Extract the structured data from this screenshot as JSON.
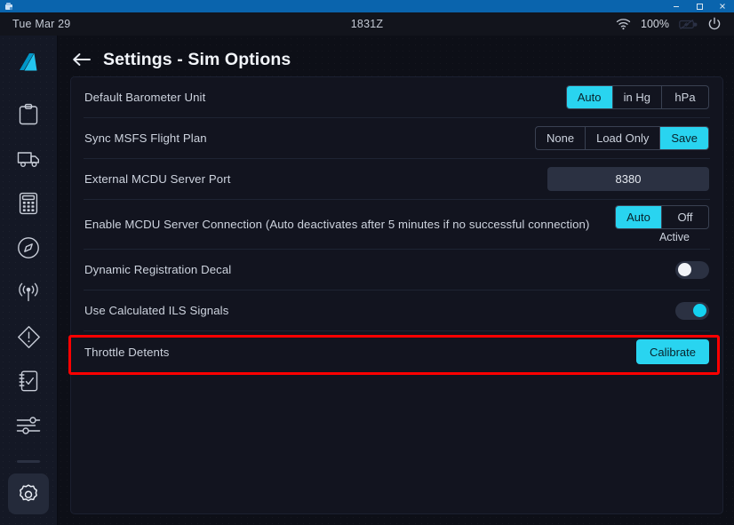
{
  "window": {
    "icon": "app-window-icon",
    "controls": [
      {
        "name": "minimize",
        "glyph": "—"
      },
      {
        "name": "maximize",
        "glyph": "☐"
      },
      {
        "name": "close",
        "glyph": "✕"
      }
    ],
    "titlebar_color": "#0a64ad"
  },
  "statusbar": {
    "date": "Tue Mar 29",
    "time": "1831Z",
    "wifi_icon": "wifi-icon",
    "battery_percent": "100%",
    "battery_icon": "battery-charging-icon",
    "power_icon": "power-icon"
  },
  "sidebar": {
    "items": [
      {
        "name": "fbw-tail-logo",
        "icon": "airplane-tail-logo-icon",
        "active": false
      },
      {
        "name": "dispatch",
        "icon": "clipboard-icon",
        "active": false
      },
      {
        "name": "ground",
        "icon": "truck-icon",
        "active": false
      },
      {
        "name": "performance",
        "icon": "calculator-icon",
        "active": false
      },
      {
        "name": "navigation",
        "icon": "compass-icon",
        "active": false
      },
      {
        "name": "atc",
        "icon": "broadcast-tower-icon",
        "active": false
      },
      {
        "name": "failures",
        "icon": "warning-diamond-icon",
        "active": false
      },
      {
        "name": "checklists",
        "icon": "checklist-notebook-icon",
        "active": false
      },
      {
        "name": "presets",
        "icon": "sliders-icon",
        "active": false
      }
    ],
    "footer": {
      "name": "settings",
      "icon": "gear-icon",
      "active": true
    }
  },
  "header": {
    "back_icon": "back-arrow-icon",
    "title": "Settings - Sim Options"
  },
  "settings": {
    "rows": [
      {
        "id": "default-barometer-unit",
        "label": "Default Barometer Unit",
        "control": "segmented",
        "options": [
          "Auto",
          "in Hg",
          "hPa"
        ],
        "selected": "Auto"
      },
      {
        "id": "sync-msfs-flight-plan",
        "label": "Sync MSFS Flight Plan",
        "control": "segmented",
        "options": [
          "None",
          "Load Only",
          "Save"
        ],
        "selected": "Save"
      },
      {
        "id": "external-mcdu-server-port",
        "label": "External MCDU Server Port",
        "control": "text",
        "value": "8380"
      },
      {
        "id": "enable-mcdu-server-connection",
        "label": "Enable MCDU Server Connection (Auto deactivates after 5 minutes if no successful connection)",
        "control": "segmented",
        "options": [
          "Auto",
          "Off"
        ],
        "selected": "Auto",
        "note": "Active"
      },
      {
        "id": "dynamic-registration-decal",
        "label": "Dynamic Registration Decal",
        "control": "toggle",
        "value": false
      },
      {
        "id": "use-calculated-ils-signals",
        "label": "Use Calculated ILS Signals",
        "control": "toggle",
        "value": true
      },
      {
        "id": "throttle-detents",
        "label": "Throttle Detents",
        "control": "button",
        "button_label": "Calibrate",
        "highlighted": true
      }
    ]
  },
  "colors": {
    "accent": "#29d4f0",
    "highlight_box": "#ff0000",
    "panel_bg": "#12141f",
    "sidebar_bg": "#141825",
    "app_bg": "#0d0f17"
  }
}
